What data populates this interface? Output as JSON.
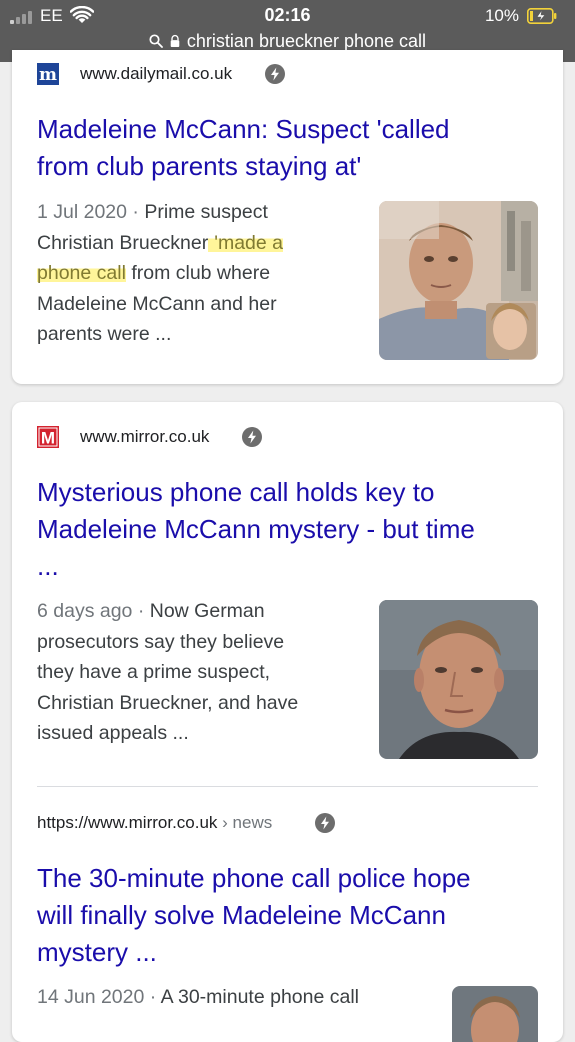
{
  "status_bar": {
    "carrier": "EE",
    "time": "02:16",
    "battery": "10%"
  },
  "url_bar": {
    "query": "christian brueckner phone call"
  },
  "results": [
    {
      "site": "www.dailymail.co.uk",
      "favicon_letter": "m",
      "title_lines": [
        "Madeleine McCann: Suspect 'called",
        "from club parents staying at'"
      ],
      "date": "1 Jul 2020",
      "snippet_l1": "Prime suspect",
      "snippet_l2_a": "Christian Brueckner",
      "snippet_l2_b": "'made a",
      "snippet_l3_a": "phone call",
      "snippet_l3_b": " from club where",
      "snippet_l4": "Madeleine McCann and her",
      "snippet_l5": "parents were ..."
    },
    {
      "site": "www.mirror.co.uk",
      "favicon_letter": "M",
      "title_lines": [
        "Mysterious phone call holds key to",
        "Madeleine McCann mystery - but time",
        "..."
      ],
      "date": "6 days ago",
      "snippet_l1": "Now German",
      "snippet_l2": "prosecutors say they believe",
      "snippet_l3": "they have a prime suspect,",
      "snippet_l4": "Christian Brueckner, and have",
      "snippet_l5": "issued appeals ..."
    },
    {
      "site_url": "https://www.mirror.co.uk",
      "breadcrumb": "› news",
      "title_lines": [
        "The 30-minute phone call police hope",
        "will finally solve Madeleine McCann",
        "mystery ..."
      ],
      "date": "14 Jun 2020",
      "snippet_l1": "A 30-minute phone call"
    }
  ],
  "separator": " · ",
  "colors": {
    "link": "#1a0dab",
    "highlight": "#fff59a",
    "mirror_red": "#d3232f",
    "dailymail_blue": "#1e4598"
  }
}
